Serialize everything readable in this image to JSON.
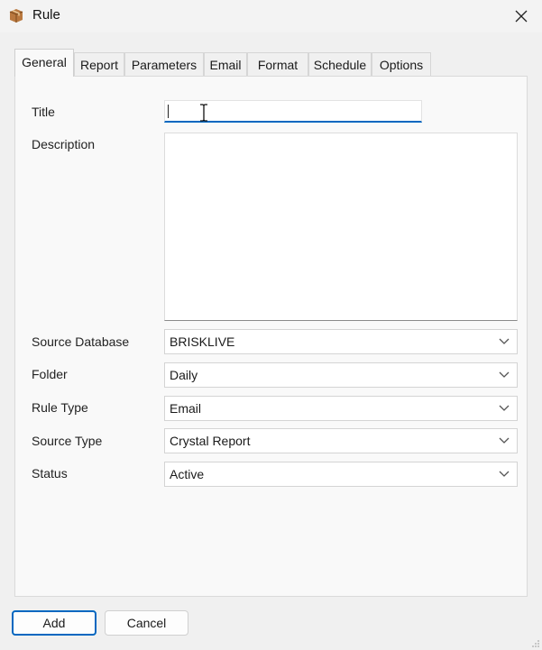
{
  "window": {
    "title": "Rule",
    "icon": "package-box-icon"
  },
  "tabs": [
    {
      "label": "General",
      "active": true
    },
    {
      "label": "Report"
    },
    {
      "label": "Parameters"
    },
    {
      "label": "Email"
    },
    {
      "label": "Format"
    },
    {
      "label": "Schedule"
    },
    {
      "label": "Options"
    }
  ],
  "form": {
    "title": {
      "label": "Title",
      "value": ""
    },
    "description": {
      "label": "Description",
      "value": ""
    },
    "source_database": {
      "label": "Source Database",
      "value": "BRISKLIVE"
    },
    "folder": {
      "label": "Folder",
      "value": "Daily"
    },
    "rule_type": {
      "label": "Rule Type",
      "value": "Email"
    },
    "source_type": {
      "label": "Source Type",
      "value": "Crystal Report"
    },
    "status": {
      "label": "Status",
      "value": "Active"
    }
  },
  "buttons": {
    "add": "Add",
    "cancel": "Cancel"
  },
  "colors": {
    "accent": "#0067c0",
    "background": "#f0f0f0",
    "panel": "#f9f9f9"
  }
}
